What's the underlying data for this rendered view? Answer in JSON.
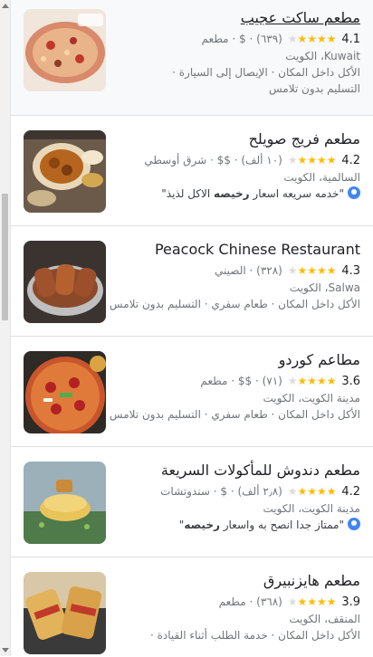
{
  "restaurants": [
    {
      "name": "مطعم ساكت عجيب",
      "rating": "4.1",
      "review_count": "(٦٣٩)",
      "price": "$",
      "category": "مطعم",
      "address": "Kuwait، الكويت",
      "services": "الأكل داخل المكان · الإيصال إلى السيارة ·",
      "services2": "التسليم بدون تلامس",
      "stars_full": 4
    },
    {
      "name": "مطعم فريج صويلح",
      "rating": "4.2",
      "review_count": "(١٠ ألف)",
      "price": "$$",
      "category": "شرق أوسطي",
      "address": "السالمية، الكويت",
      "review_snippet_pre": "\"خدمه سريعه اسعار ",
      "review_snippet_bold": "رخيصه",
      "review_snippet_post": " الاكل لذيذ\"",
      "stars_full": 4
    },
    {
      "name": "Peacock Chinese Restaurant",
      "rating": "4.3",
      "review_count": "(٣٢٨)",
      "category": "الصيني",
      "address": "Salwa، الكويت",
      "services": "الأكل داخل المكان · طعام سفري · التسليم بدون تلامس",
      "stars_full": 4
    },
    {
      "name": "مطاعم كوردو",
      "rating": "3.6",
      "review_count": "(٧١)",
      "price": "$$",
      "category": "مطعم",
      "address": "مدينة الكويت، الكويت",
      "services": "الأكل داخل المكان · طعام سفري · التسليم بدون تلامس",
      "stars_full": 4
    },
    {
      "name": "مطعم دندوش للمأكولات السريعة",
      "rating": "4.2",
      "review_count": "(٢٫٨ ألف)",
      "price": "$",
      "category": "سندوتشات",
      "address": "مدينة الكويت، الكويت",
      "review_snippet_pre": "\"ممتاز جدا انصح به واسعار ",
      "review_snippet_bold": "رخيصه",
      "review_snippet_post": "\"",
      "stars_full": 4
    },
    {
      "name": "مطعم هايزنبيرق",
      "rating": "3.9",
      "review_count": "(٣٦٨)",
      "category": "مطعم",
      "address": "المنقف، الكويت",
      "services": "الأكل داخل المكان · خدمة الطلب أثناء القيادة ·",
      "stars_full": 4
    }
  ],
  "icons": {
    "star": "★",
    "reviewer": "avatar-icon"
  },
  "colors": {
    "star": "#fbbc04",
    "secondary_text": "#70757a",
    "reviewer_icon": "#4285f4"
  }
}
